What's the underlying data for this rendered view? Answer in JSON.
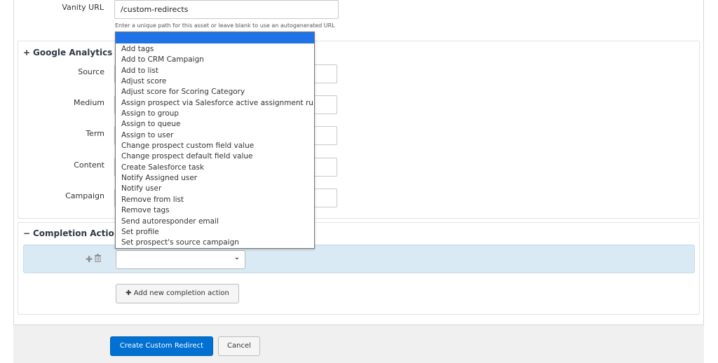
{
  "vanity": {
    "label": "Vanity URL",
    "value": "/custom-redirects",
    "helper": "Enter a unique path for this asset or leave blank to use an autogenerated URL"
  },
  "google_analytics": {
    "title": "Google Analytics P",
    "toggle_glyph": "+",
    "fields": [
      {
        "label": "Source"
      },
      {
        "label": "Medium"
      },
      {
        "label": "Term"
      },
      {
        "label": "Content"
      },
      {
        "label": "Campaign"
      }
    ]
  },
  "completion_actions": {
    "title": "Completion Actio",
    "toggle_glyph": "−",
    "add_button_label": "Add new completion action",
    "add_icon": "plus-icon",
    "row_icons": [
      "plus-icon",
      "trash-icon"
    ]
  },
  "dropdown": {
    "options": [
      "",
      "Add tags",
      "Add to CRM Campaign",
      "Add to list",
      "Adjust score",
      "Adjust score for Scoring Category",
      "Assign prospect via Salesforce active assignment rule",
      "Assign to group",
      "Assign to queue",
      "Assign to user",
      "Change prospect custom field value",
      "Change prospect default field value",
      "Create Salesforce task",
      "Notify Assigned user",
      "Notify user",
      "Remove from list",
      "Remove tags",
      "Send autoresponder email",
      "Set profile",
      "Set prospect's source campaign"
    ]
  },
  "footer": {
    "create_label": "Create Custom Redirect",
    "cancel_label": "Cancel"
  },
  "colors": {
    "primary": "#0070d2",
    "row_highlight": "#d9eaf5",
    "option_highlight": "#1f73e6"
  }
}
